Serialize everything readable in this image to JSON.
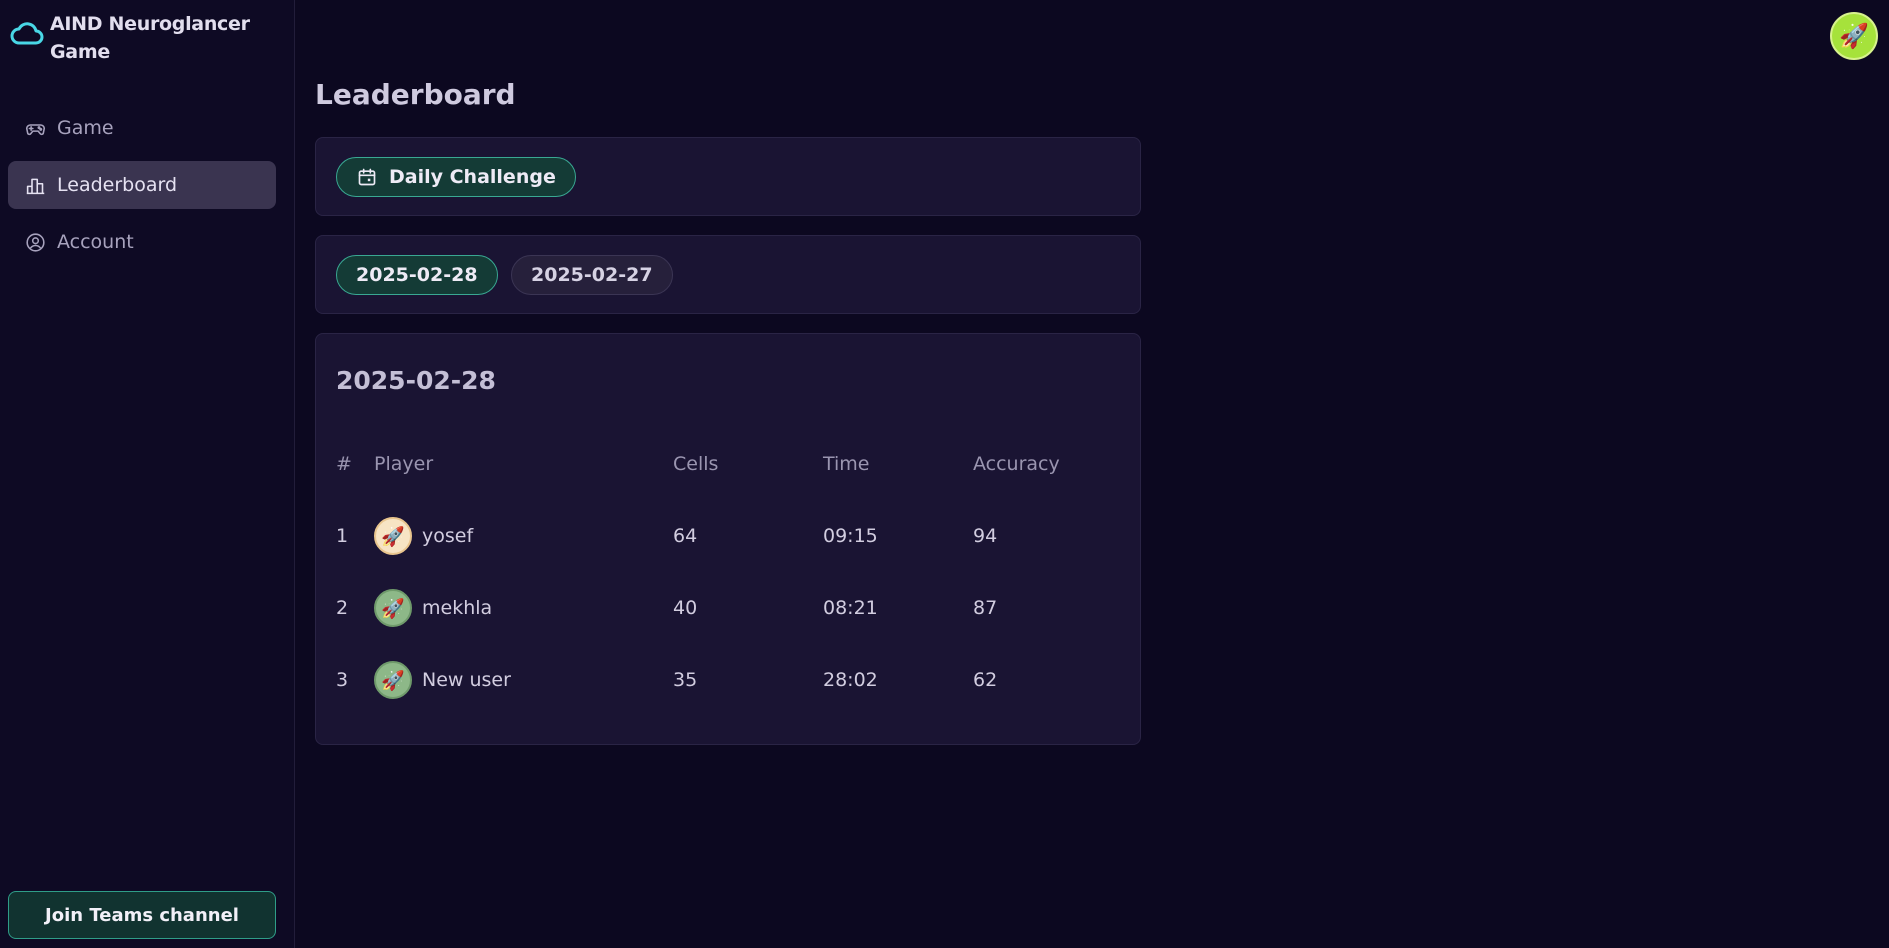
{
  "app": {
    "title": "AIND Neuroglancer Game"
  },
  "sidebar": {
    "items": [
      {
        "label": "Game",
        "icon": "gamepad-icon",
        "active": false
      },
      {
        "label": "Leaderboard",
        "icon": "bar-chart-icon",
        "active": true
      },
      {
        "label": "Account",
        "icon": "user-circle-icon",
        "active": false
      }
    ],
    "join_button": "Join Teams channel"
  },
  "header": {
    "avatar_emoji": "🚀"
  },
  "page": {
    "title": "Leaderboard",
    "challenge_button": "Daily Challenge",
    "dates": [
      "2025-02-28",
      "2025-02-27"
    ],
    "selected_date": "2025-02-28"
  },
  "leaderboard": {
    "heading": "2025-02-28",
    "columns": [
      "#",
      "Player",
      "Cells",
      "Time",
      "Accuracy"
    ],
    "rows": [
      {
        "rank": "1",
        "player": "yosef",
        "avatar": "🚀",
        "avatar_color": "#f7e4c4",
        "cells": "64",
        "time": "09:15",
        "accuracy": "94"
      },
      {
        "rank": "2",
        "player": "mekhla",
        "avatar": "🚀",
        "avatar_color": "#8db888",
        "cells": "40",
        "time": "08:21",
        "accuracy": "87"
      },
      {
        "rank": "3",
        "player": "New user",
        "avatar": "🚀",
        "avatar_color": "#8db888",
        "cells": "35",
        "time": "28:02",
        "accuracy": "62"
      }
    ]
  },
  "colors": {
    "accent": "#39a892",
    "background": "#0c0820",
    "card": "#1a1433"
  }
}
